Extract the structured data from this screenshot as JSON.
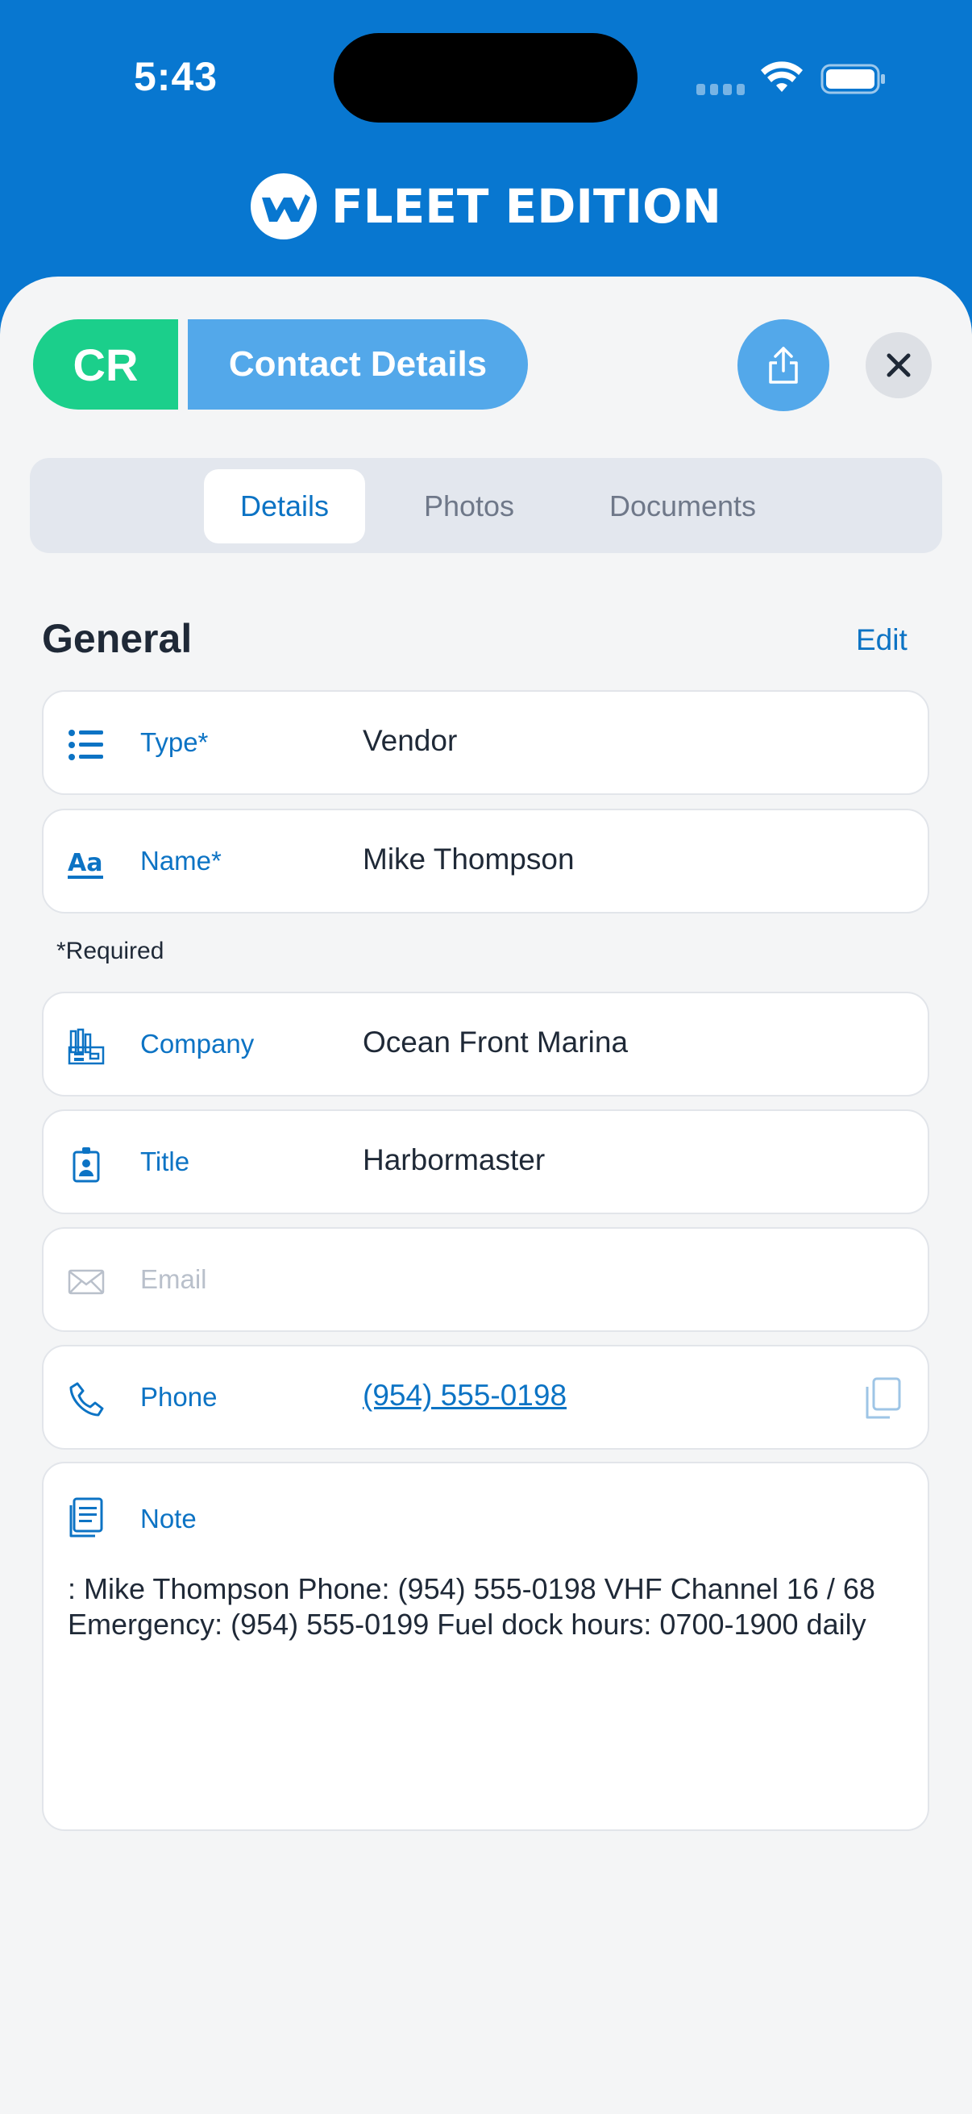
{
  "status_bar": {
    "time": "5:43"
  },
  "brand": {
    "title": "FLEET EDITION",
    "logo_icon": "fleet-logo-icon",
    "color": "#0877d0"
  },
  "header": {
    "badge": "CR",
    "badge_color": "#1bcf8b",
    "title": "Contact Details",
    "title_color": "#53a8ea",
    "share_icon": "share-icon",
    "close_icon": "close-icon"
  },
  "tabs": [
    {
      "label": "Details",
      "active": true
    },
    {
      "label": "Photos",
      "active": false
    },
    {
      "label": "Documents",
      "active": false
    }
  ],
  "general": {
    "title": "General",
    "edit_label": "Edit",
    "required_note": "*Required",
    "fields": {
      "type": {
        "label": "Type*",
        "value": "Vendor",
        "icon": "list-icon"
      },
      "name": {
        "label": "Name*",
        "value": "Mike Thompson",
        "icon": "text-format-icon"
      },
      "company": {
        "label": "Company",
        "value": "Ocean Front Marina",
        "icon": "building-icon"
      },
      "title": {
        "label": "Title",
        "value": "Harbormaster",
        "icon": "id-badge-icon"
      },
      "email": {
        "label": "Email",
        "value": "",
        "icon": "envelope-icon"
      },
      "phone": {
        "label": "Phone",
        "value": "(954) 555-0198",
        "icon": "phone-icon",
        "action_icon": "copy-icon"
      }
    },
    "note": {
      "label": "Note",
      "icon": "note-icon",
      "text": ": Mike Thompson Phone: (954) 555-0198 VHF Channel 16 / 68 Emergency: (954) 555-0199 Fuel dock hours: 0700-1900 daily"
    }
  },
  "colors": {
    "accent": "#0c73c4",
    "sheet_background": "#f4f5f6"
  }
}
